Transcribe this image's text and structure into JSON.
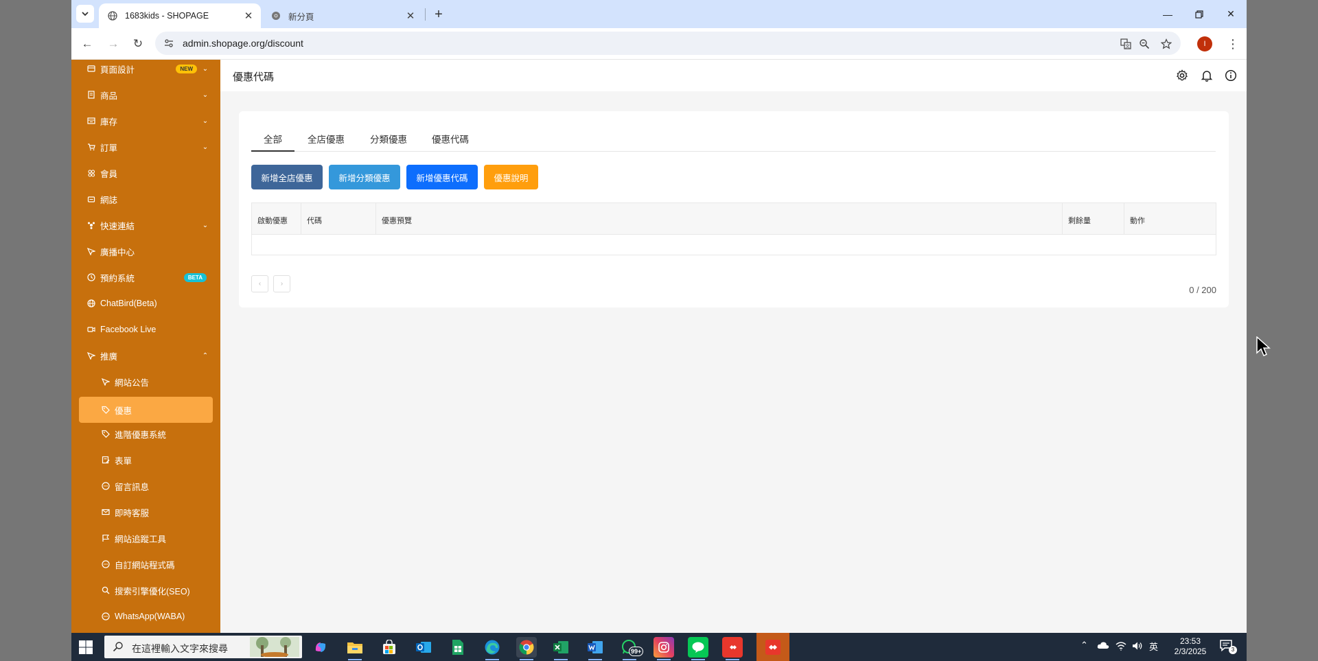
{
  "browser": {
    "tabs": [
      {
        "title": "1683kids - SHOPAGE"
      },
      {
        "title": "新分頁"
      }
    ],
    "url": "admin.shopage.org/discount"
  },
  "sidebar": {
    "items": [
      {
        "label": "頁面設計",
        "badge": "NEW"
      },
      {
        "label": "商品"
      },
      {
        "label": "庫存"
      },
      {
        "label": "訂單"
      },
      {
        "label": "會員"
      },
      {
        "label": "網誌"
      },
      {
        "label": "快速連結"
      },
      {
        "label": "廣播中心"
      },
      {
        "label": "預約系統",
        "badge": "BETA"
      },
      {
        "label": "ChatBird(Beta)"
      },
      {
        "label": "Facebook Live"
      },
      {
        "label": "推廣"
      },
      {
        "label": "網站公告"
      },
      {
        "label": "優惠"
      },
      {
        "label": "進階優惠系統"
      },
      {
        "label": "表單"
      },
      {
        "label": "留言訊息"
      },
      {
        "label": "即時客服"
      },
      {
        "label": "網站追蹤工具"
      },
      {
        "label": "自訂網站程式碼"
      },
      {
        "label": "搜索引擎優化(SEO)"
      },
      {
        "label": "WhatsApp(WABA)"
      }
    ]
  },
  "main": {
    "title": "優惠代碼",
    "tabs": [
      {
        "label": "全部"
      },
      {
        "label": "全店優惠"
      },
      {
        "label": "分類優惠"
      },
      {
        "label": "優惠代碼"
      }
    ],
    "buttons": {
      "add_store": "新增全店優惠",
      "add_category": "新增分類優惠",
      "add_code": "新增優惠代碼",
      "help": "優惠說明"
    },
    "table": {
      "columns": [
        "啟動優惠",
        "代碼",
        "優惠預覽",
        "剩餘量",
        "動作"
      ],
      "rows": []
    },
    "pager": {
      "prev": "‹",
      "next": "›"
    },
    "counter": "0 / 200"
  },
  "taskbar": {
    "search_placeholder": "在這裡輸入文字來搜尋",
    "whatsapp_badge": "99+",
    "ime": "英",
    "time": "23:53",
    "date": "2/3/2025",
    "notifications": "3"
  },
  "colors": {
    "sidebar": "#c7700d",
    "sidebar_active": "#fba843",
    "btn_store": "#3e6699",
    "btn_category": "#3498db",
    "btn_code": "#0d6efd",
    "btn_help": "#ff9e0d"
  }
}
